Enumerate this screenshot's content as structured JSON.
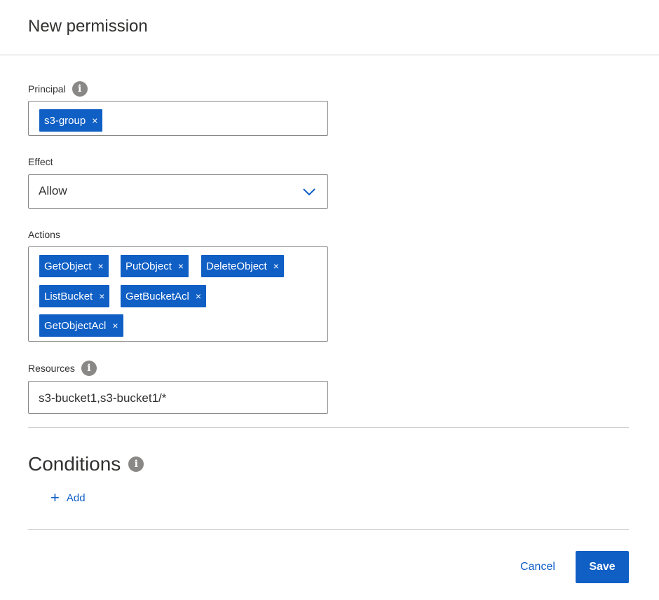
{
  "header": {
    "title": "New permission"
  },
  "principal": {
    "label": "Principal",
    "tags": [
      "s3-group"
    ],
    "remove_glyph": "×"
  },
  "effect": {
    "label": "Effect",
    "selected": "Allow"
  },
  "actions": {
    "label": "Actions",
    "tags": [
      "GetObject",
      "PutObject",
      "DeleteObject",
      "ListBucket",
      "GetBucketAcl",
      "GetObjectAcl"
    ],
    "remove_glyph": "×"
  },
  "resources": {
    "label": "Resources",
    "value": "s3-bucket1,s3-bucket1/*"
  },
  "conditions": {
    "title": "Conditions",
    "add_label": "Add"
  },
  "footer": {
    "cancel_label": "Cancel",
    "save_label": "Save"
  },
  "icons": {
    "info": "info-icon",
    "chevron": "chevron-down-icon",
    "add": "plus-icon",
    "remove": "close-icon"
  },
  "colors": {
    "accent": "#0f5fc5",
    "tag_text": "#ffffff",
    "border": "#8a8886",
    "divider": "#d2d0ce",
    "info_icon": "#8a8886"
  }
}
